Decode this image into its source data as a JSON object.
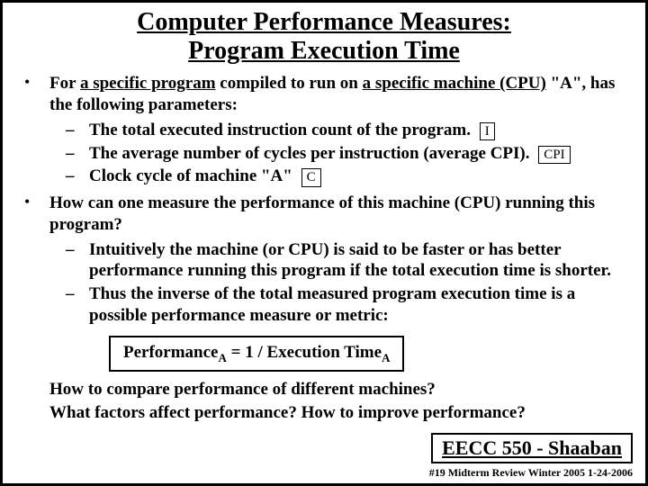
{
  "title_line1": "Computer Performance Measures:",
  "title_line2": "Program Execution Time",
  "p1_pre": "For ",
  "p1_u1": "a specific program",
  "p1_mid": " compiled to run on ",
  "p1_u2": "a specific machine (CPU)",
  "p1_post": " \"A\", has the following parameters:",
  "s1": "The total executed instruction count of the program.",
  "s1_box": "I",
  "s2": "The average number of cycles per instruction (average CPI).",
  "s2_box": "CPI",
  "s3": "Clock cycle of machine \"A\"",
  "s3_box": "C",
  "p2": "How can one measure the performance of this machine (CPU) running this program?",
  "s4": "Intuitively the machine (or CPU) is said to be faster or has better performance running this program if the total execution time is shorter.",
  "s5": "Thus the inverse of the total measured program execution time is a possible performance measure or metric:",
  "formula_lhs": "Performance",
  "formula_subA": "A",
  "formula_mid": "  =   1  /   Execution Time",
  "q1": "How to compare performance of different machines?",
  "q2": "What factors affect performance?  How to improve performance?",
  "course": "EECC 550 - Shaaban",
  "meta": "#19   Midterm Review  Winter 2005  1-24-2006"
}
